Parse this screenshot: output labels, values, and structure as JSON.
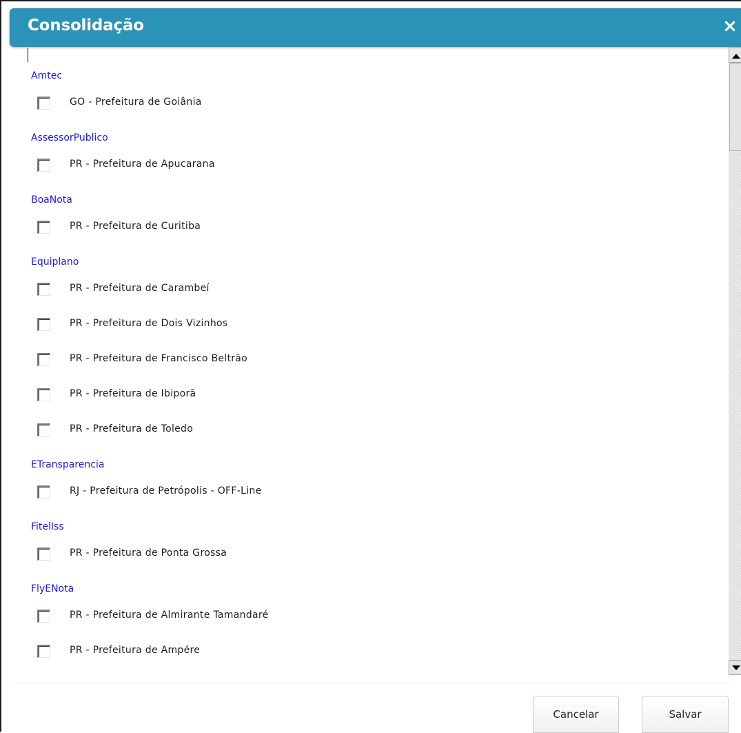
{
  "dialog": {
    "title": "Consolidação",
    "close_symbol": "×"
  },
  "groups": [
    {
      "label": "Amtec",
      "items": [
        "GO - Prefeitura de Goiânia"
      ]
    },
    {
      "label": "AssessorPublico",
      "items": [
        "PR - Prefeitura de Apucarana"
      ]
    },
    {
      "label": "BoaNota",
      "items": [
        "PR - Prefeitura de Curitiba"
      ]
    },
    {
      "label": "Equiplano",
      "items": [
        "PR - Prefeitura de Carambeí",
        "PR - Prefeitura de Dois Vizinhos",
        "PR - Prefeitura de Francisco Beltrão",
        "PR - Prefeitura de Ibiporã",
        "PR - Prefeitura de Toledo"
      ]
    },
    {
      "label": "ETransparencia",
      "items": [
        "RJ - Prefeitura de Petrópolis - OFF-Line"
      ]
    },
    {
      "label": "FitelIss",
      "items": [
        "PR - Prefeitura de Ponta Grossa"
      ]
    },
    {
      "label": "FlyENota",
      "items": [
        "PR - Prefeitura de Almirante Tamandaré",
        "PR - Prefeitura de Ampére"
      ]
    }
  ],
  "footer": {
    "cancel_label": "Cancelar",
    "save_label": "Salvar"
  },
  "colors": {
    "header_bg": "#2a93b7",
    "group_label": "#1a1aee"
  },
  "icons": {
    "close": "close-icon",
    "scroll_up": "scroll-up-arrow-icon",
    "scroll_down": "scroll-down-arrow-icon"
  }
}
